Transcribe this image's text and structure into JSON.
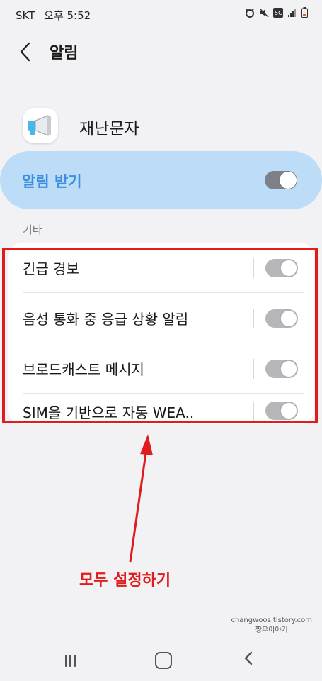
{
  "status_bar": {
    "carrier": "SKT",
    "time": "오후 5:52",
    "icons": [
      "alarm-icon",
      "mute-icon",
      "5g-icon",
      "signal-icon",
      "battery-icon"
    ]
  },
  "header": {
    "back_icon": "chevron-left-icon",
    "title": "알림"
  },
  "app": {
    "icon": "megaphone-icon",
    "name": "재난문자"
  },
  "main_toggle": {
    "label": "알림 받기",
    "on": true,
    "bg_color": "#bcdcf7",
    "label_color": "#3b8ee0"
  },
  "section": {
    "title": "기타"
  },
  "items": [
    {
      "label": "긴급 경보",
      "on": true
    },
    {
      "label": "음성 통화 중 응급 상황 알림",
      "on": true
    },
    {
      "label": "브로드캐스트 메시지",
      "on": true
    },
    {
      "label": "SIM을 기반으로 자동 WEA..",
      "on": true
    }
  ],
  "annotation": {
    "callout": "모두 설정하기",
    "color": "#e01c1c"
  },
  "watermark": {
    "line1": "changwoos.tistory.com",
    "line2": "짱우이야기"
  },
  "nav_bar": {
    "recents_icon": "recents-icon",
    "home_icon": "home-icon",
    "back_icon": "back-icon"
  }
}
